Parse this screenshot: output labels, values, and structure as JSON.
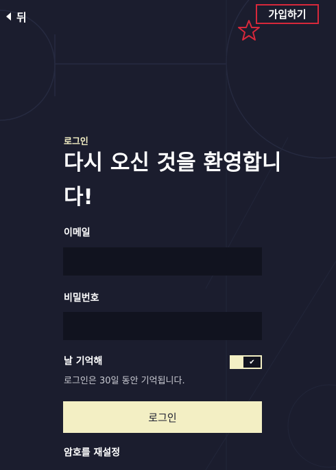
{
  "header": {
    "back_label": "뒤",
    "signup_label": "가입하기"
  },
  "login": {
    "eyebrow": "로그인",
    "title": "다시 오신 것을 환영합니다!",
    "email_label": "이메일",
    "email_value": "",
    "password_label": "비밀번호",
    "password_value": "",
    "remember_label": "날 기억해",
    "remember_checked": true,
    "remember_check_glyph": "✔",
    "remember_note": "로그인은 30일 동안 기억됩니다.",
    "submit_label": "로그인",
    "reset_link": "암호를 재설정"
  },
  "colors": {
    "background": "#1b1d2e",
    "input_background": "#11131f",
    "accent": "#f3efc4",
    "highlight_red": "#d8283b"
  },
  "icons": {
    "back": "back-arrow-icon",
    "star": "star-icon",
    "toggle_check": "check-icon"
  }
}
